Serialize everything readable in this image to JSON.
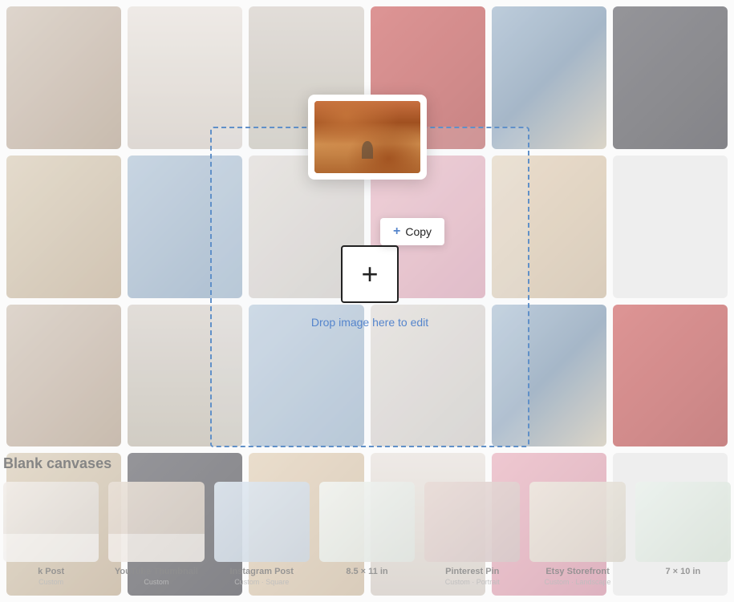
{
  "background": {
    "cards": [
      {
        "id": "bg1",
        "class": "img-1"
      },
      {
        "id": "bg2",
        "class": "img-fashion1"
      },
      {
        "id": "bg3",
        "class": "img-fashion2"
      },
      {
        "id": "bg4",
        "class": "img-red"
      },
      {
        "id": "bg5",
        "class": "img-2"
      },
      {
        "id": "bg6",
        "class": "img-dark"
      },
      {
        "id": "bg7",
        "class": "img-3"
      },
      {
        "id": "bg8",
        "class": "img-social"
      },
      {
        "id": "bg9",
        "class": "img-layout"
      },
      {
        "id": "bg10",
        "class": "img-pink"
      },
      {
        "id": "bg11",
        "class": "img-warm"
      },
      {
        "id": "bg12",
        "class": "img-blue-geo"
      }
    ]
  },
  "drop_zone": {
    "drop_text": "Drop image here to edit"
  },
  "copy_button": {
    "label": "Copy",
    "plus_icon": "+"
  },
  "blank_canvases": {
    "label": "Blank canvases"
  },
  "template_cards": [
    {
      "title": "k Post",
      "sub": "Custom",
      "size": "",
      "thumb_class": "thumb-fb",
      "show_size": false
    },
    {
      "title": "YouTube Thumbnail",
      "sub": "",
      "size": "Custom",
      "thumb_class": "thumb-yt",
      "show_size": true
    },
    {
      "title": "Instagram Post",
      "sub": "Custom · Square",
      "size": "",
      "thumb_class": "thumb-ig",
      "show_size": false
    },
    {
      "title": "8.5 × 11 in",
      "sub": "",
      "size": "",
      "thumb_class": "thumb-letter",
      "show_size": false
    },
    {
      "title": "Pinterest Pin",
      "sub": "",
      "size": "Custom · Portrait",
      "thumb_class": "thumb-pin",
      "show_size": true
    },
    {
      "title": "Etsy Storefront Banner",
      "sub": "Custom · Landscape",
      "size": "",
      "thumb_class": "thumb-etsy",
      "show_size": false
    },
    {
      "title": "7 × 10 in",
      "sub": "",
      "size": "",
      "thumb_class": "thumb-7x10",
      "show_size": false
    }
  ]
}
